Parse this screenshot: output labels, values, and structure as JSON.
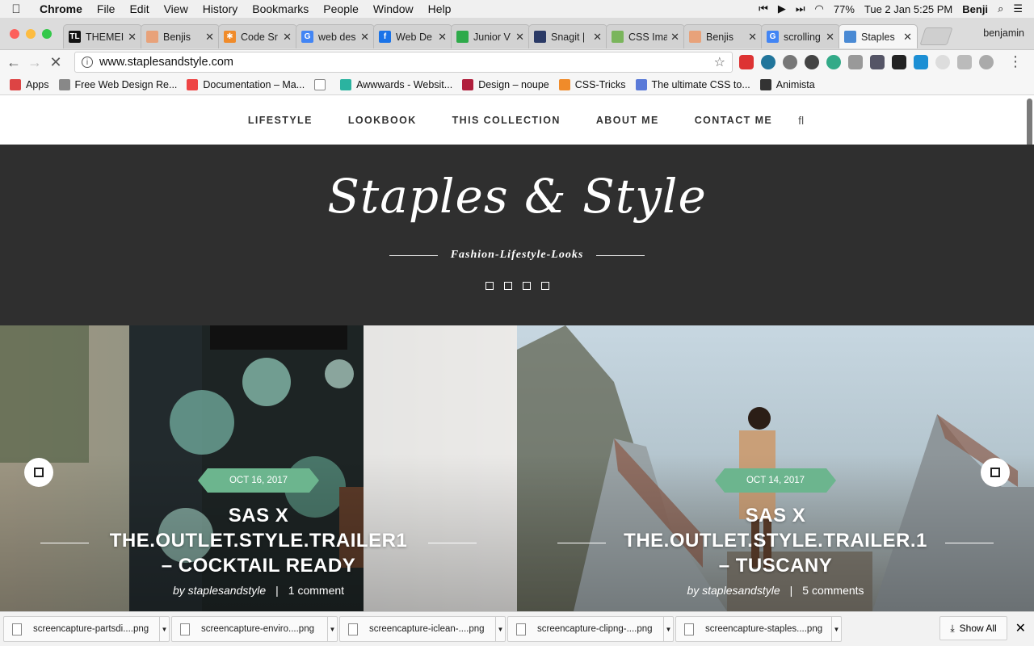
{
  "menubar": {
    "app": "Chrome",
    "items": [
      "File",
      "Edit",
      "View",
      "History",
      "Bookmarks",
      "People",
      "Window",
      "Help"
    ],
    "battery": "77%",
    "clock": "Tue 2 Jan  5:25 PM",
    "user": "Benji"
  },
  "tabs": [
    {
      "title": "THEMEI",
      "color": "#111111",
      "glyph": "TL"
    },
    {
      "title": "Benjis",
      "color": "#e8a27a",
      "glyph": ""
    },
    {
      "title": "Code Sr",
      "color": "#f08b2a",
      "glyph": "✱"
    },
    {
      "title": "web des",
      "color": "#4285f4",
      "glyph": "G"
    },
    {
      "title": "Web De",
      "color": "#1a73e8",
      "glyph": "f"
    },
    {
      "title": "Junior V",
      "color": "#2eaa4a",
      "glyph": ""
    },
    {
      "title": "Snagit |",
      "color": "#2b3a66",
      "glyph": ""
    },
    {
      "title": "CSS Ima",
      "color": "#7ab55c",
      "glyph": ""
    },
    {
      "title": "Benjis",
      "color": "#e8a27a",
      "glyph": ""
    },
    {
      "title": "scrolling",
      "color": "#4285f4",
      "glyph": "G"
    },
    {
      "title": "Staples",
      "color": "#4a8ad4",
      "glyph": ""
    }
  ],
  "profile": "benjamin",
  "omnibox": {
    "url": "www.staplesandstyle.com"
  },
  "bookmarks": [
    {
      "label": "Apps",
      "color": "#d44"
    },
    {
      "label": "Free Web Design Re...",
      "color": "#888"
    },
    {
      "label": "Documentation – Ma...",
      "color": "#e44"
    },
    {
      "label": "",
      "color": "#fff"
    },
    {
      "label": "Awwwards - Websit...",
      "color": "#2bb3a0"
    },
    {
      "label": "Design – noupe",
      "color": "#b01f3c"
    },
    {
      "label": "CSS-Tricks",
      "color": "#f08b2a"
    },
    {
      "label": "The ultimate CSS to...",
      "color": "#5a7ad8"
    },
    {
      "label": "Animista",
      "color": "#333"
    }
  ],
  "site": {
    "nav": [
      "LIFESTYLE",
      "LOOKBOOK",
      "THIS COLLECTION",
      "ABOUT ME",
      "CONTACT ME"
    ],
    "logo": "Staples & Style",
    "tagline": "Fashion-Lifestyle-Looks",
    "posts": [
      {
        "date": "OCT 16, 2017",
        "title_line1": "SAS X",
        "title_line2": "THE.OUTLET.STYLE.TRAILER1",
        "title_line3": "– COCKTAIL READY",
        "author": "by staplesandstyle",
        "comments": "1 comment"
      },
      {
        "date": "OCT 14, 2017",
        "title_line1": "SAS X",
        "title_line2": "THE.OUTLET.STYLE.TRAILER.1",
        "title_line3": "– TUSCANY",
        "author": "by staplesandstyle",
        "comments": "5 comments"
      }
    ]
  },
  "downloads": [
    "screencapture-partsdi....png",
    "screencapture-enviro....png",
    "screencapture-iclean-....png",
    "screencapture-clipng-....png",
    "screencapture-staples....png"
  ],
  "show_all": "Show All",
  "colors": {
    "accent_green": "#6cb58e",
    "hero_bg": "#2f2f2f"
  }
}
